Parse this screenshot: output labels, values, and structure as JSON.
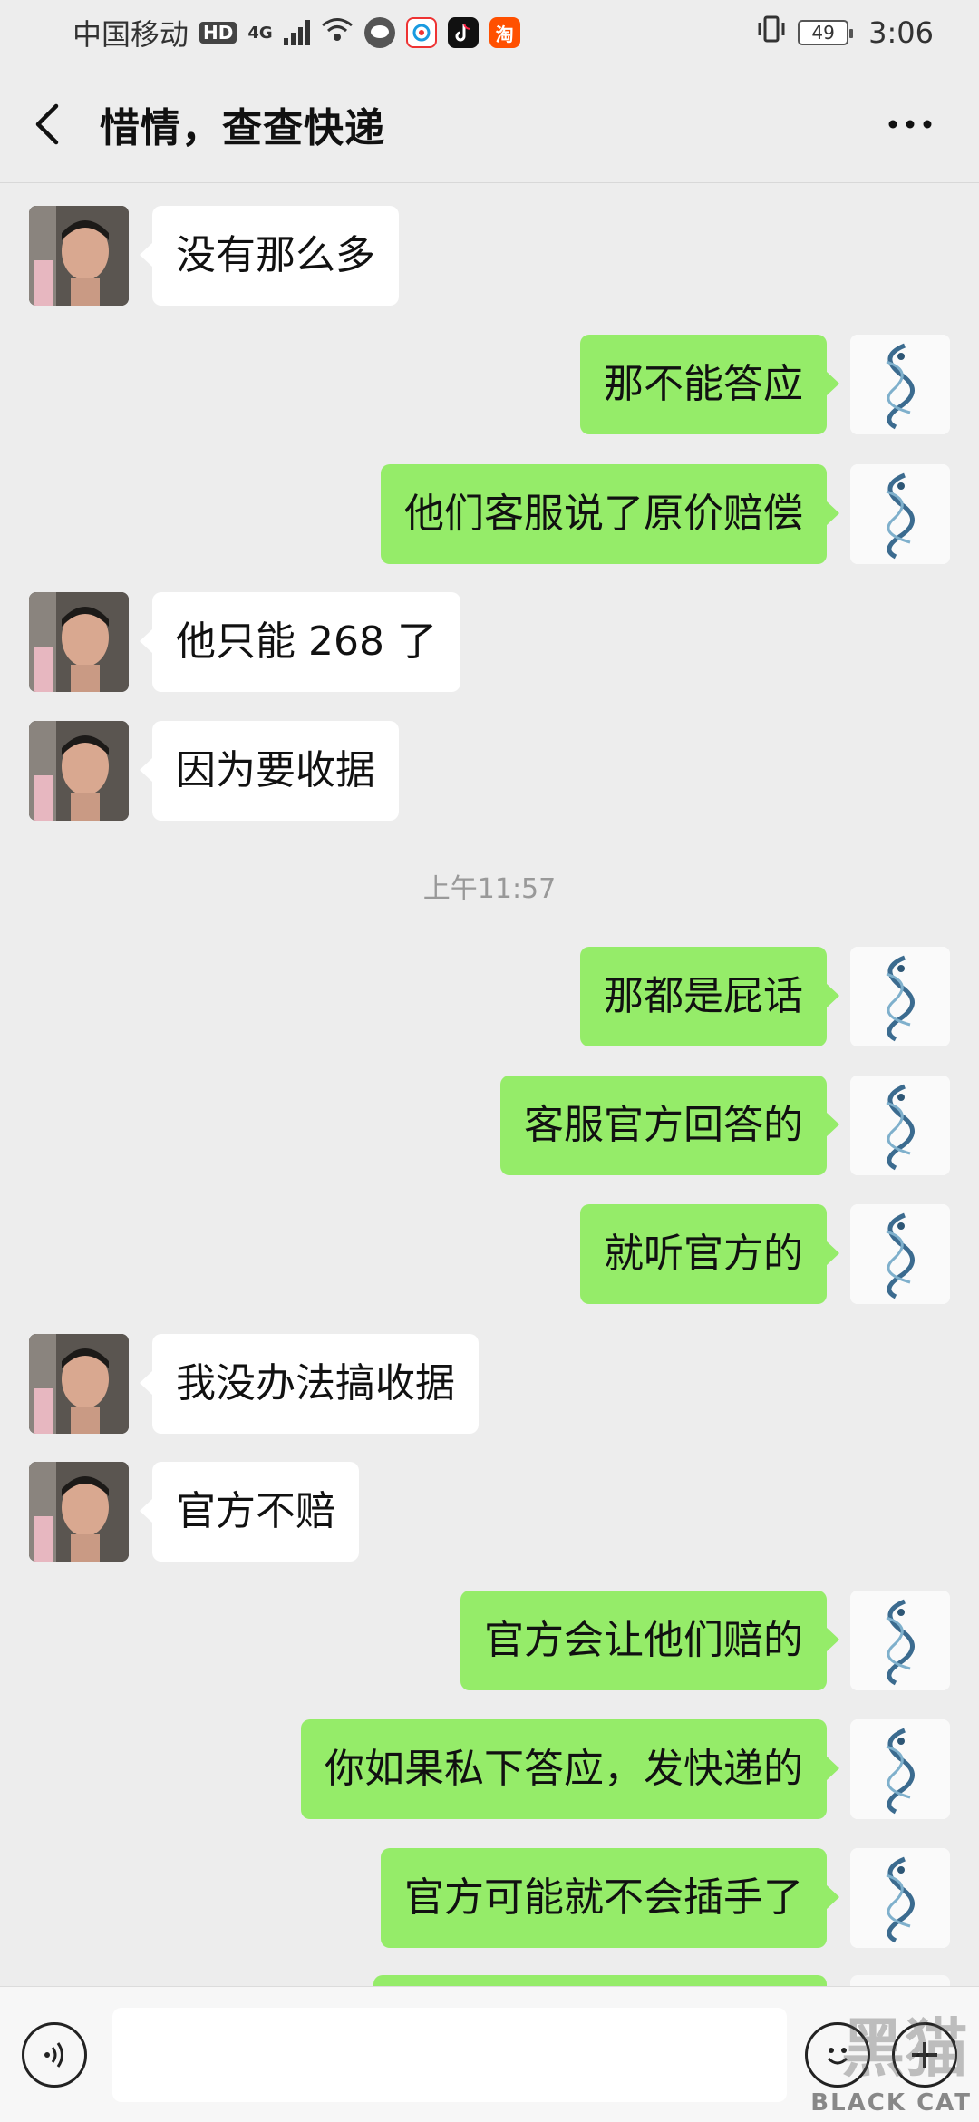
{
  "status_bar": {
    "carrier": "中国移动",
    "hd": "HD",
    "network": "4G",
    "battery": "49",
    "time": "3:06",
    "app_icons": [
      "message-icon",
      "weibo-icon",
      "tiktok-icon",
      "taobao-icon"
    ],
    "taobao_char": "淘"
  },
  "header": {
    "title": "惜情，查查快递",
    "back_icon": "chevron-left-icon",
    "more_icon": "ellipsis-icon"
  },
  "messages": [
    {
      "side": "left",
      "text": "没有那么多"
    },
    {
      "side": "right",
      "text": "那不能答应"
    },
    {
      "side": "right",
      "text": "他们客服说了原价赔偿"
    },
    {
      "side": "left",
      "text": "他只能 268 了"
    },
    {
      "side": "left",
      "text": "因为要收据"
    },
    {
      "timestamp": "上午11:57"
    },
    {
      "side": "right",
      "text": "那都是屁话"
    },
    {
      "side": "right",
      "text": "客服官方回答的"
    },
    {
      "side": "right",
      "text": "就听官方的"
    },
    {
      "side": "left",
      "text": "我没办法搞收据"
    },
    {
      "side": "left",
      "text": "官方不赔"
    },
    {
      "side": "right",
      "text": "官方会让他们赔的"
    },
    {
      "side": "right",
      "text": "你如果私下答应，发快递的"
    },
    {
      "side": "right",
      "text": "官方可能就不会插手了"
    }
  ],
  "input_bar": {
    "voice_icon": "voice-icon",
    "emoji_icon": "emoji-icon",
    "plus_icon": "plus-icon",
    "value": ""
  },
  "watermark": {
    "text": "BLACK CAT",
    "cn": "黑猫"
  },
  "colors": {
    "background": "#ededed",
    "bubble_sent": "#95ec69",
    "bubble_received": "#ffffff"
  }
}
